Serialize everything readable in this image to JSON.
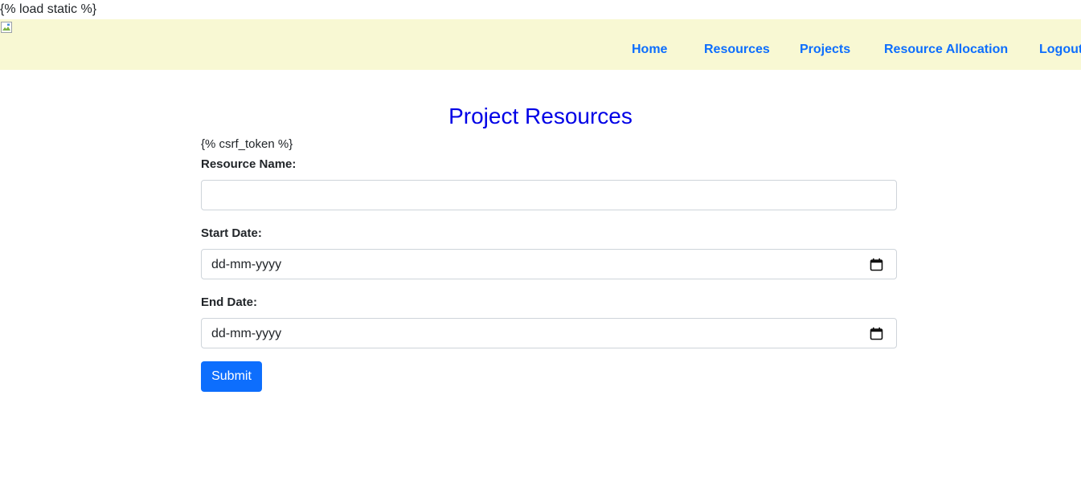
{
  "template_tags": {
    "load_static": "{% load static %}",
    "csrf_token": "{% csrf_token %}"
  },
  "navbar": {
    "logo_icon": "broken-image-icon",
    "items": [
      {
        "label": "Home"
      },
      {
        "label": "Resources"
      },
      {
        "label": "Projects"
      },
      {
        "label": "Resource Allocation"
      },
      {
        "label": "Logout"
      }
    ],
    "colors": {
      "background": "#f8f8d3",
      "link": "#0d6efd"
    }
  },
  "page": {
    "title": "Project Resources",
    "title_color": "#0000e6"
  },
  "form": {
    "resource_name": {
      "label": "Resource Name:",
      "value": ""
    },
    "start_date": {
      "label": "Start Date:",
      "placeholder": "dd-mm-yyyy",
      "icon": "calendar-icon"
    },
    "end_date": {
      "label": "End Date:",
      "placeholder": "dd-mm-yyyy",
      "icon": "calendar-icon"
    },
    "submit_label": "Submit",
    "submit_color": "#0d6efd"
  }
}
